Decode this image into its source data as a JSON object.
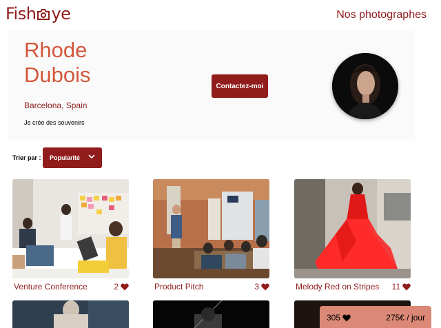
{
  "logo": {
    "before": "Fish",
    "after": "ye"
  },
  "nav": {
    "title": "Nos photographes"
  },
  "photographer": {
    "name_line1": "Rhode",
    "name_line2": "Dubois",
    "location": "Barcelona, Spain",
    "tagline": "Je crée des souvenirs",
    "contact_label": "Contactez-moi"
  },
  "sort": {
    "label": "Trier par :",
    "selected": "Popularité"
  },
  "media": [
    {
      "title": "Venture Conference",
      "likes": "2"
    },
    {
      "title": "Product Pitch",
      "likes": "3"
    },
    {
      "title": "Melody Red on Stripes",
      "likes": "11"
    }
  ],
  "footer": {
    "total_likes": "305",
    "price": "275€ / jour"
  },
  "colors": {
    "primary": "#901c1c",
    "accent": "#d3573c",
    "footer_bg": "#db8876",
    "header_bg": "#fafafa"
  }
}
